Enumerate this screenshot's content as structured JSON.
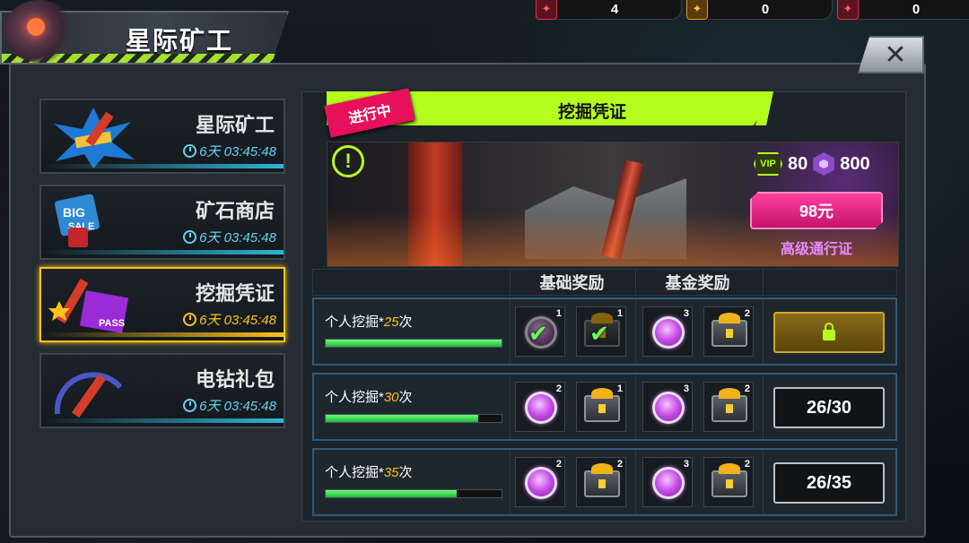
{
  "resources": [
    {
      "icon": "red-drill-icon",
      "value": "4",
      "color": "#e0304a"
    },
    {
      "icon": "gold-drill-icon",
      "value": "0",
      "color": "#e39a1a"
    },
    {
      "icon": "pink-drill-icon",
      "value": "0",
      "color": "#e0304a"
    }
  ],
  "title": "星际矿工",
  "tabs": [
    {
      "name": "星际矿工",
      "time": "6天 03:45:48",
      "art": "mining-sale-icon",
      "active": false
    },
    {
      "name": "矿石商店",
      "time": "6天 03:45:48",
      "art": "big-sale-icon",
      "active": false
    },
    {
      "name": "挖掘凭证",
      "time": "6天 03:45:48",
      "art": "pass-icon",
      "active": true
    },
    {
      "name": "电钻礼包",
      "time": "6天 03:45:48",
      "art": "drill-pack-icon",
      "active": false
    }
  ],
  "event": {
    "status": "进行中",
    "title": "挖掘凭证",
    "vip": "VIP",
    "vip_points": "80",
    "gems": "800",
    "price": "98元",
    "pass_name": "高级通行证"
  },
  "columns": {
    "basic": "基础奖励",
    "fund": "基金奖励"
  },
  "rows": [
    {
      "label": "个人挖掘*",
      "count": "25",
      "suffix": "次",
      "progress": 1.0,
      "items": [
        {
          "type": "bottlecap",
          "qty": "1",
          "claimed": true
        },
        {
          "type": "chest",
          "qty": "1",
          "claimed": true
        },
        {
          "type": "bottlecap",
          "qty": "3",
          "claimed": false
        },
        {
          "type": "chest",
          "qty": "2",
          "claimed": false
        }
      ],
      "action": "",
      "locked": true
    },
    {
      "label": "个人挖掘*",
      "count": "30",
      "suffix": "次",
      "progress": 0.867,
      "items": [
        {
          "type": "bottlecap",
          "qty": "2",
          "claimed": false
        },
        {
          "type": "chest",
          "qty": "1",
          "claimed": false
        },
        {
          "type": "bottlecap",
          "qty": "3",
          "claimed": false
        },
        {
          "type": "chest",
          "qty": "2",
          "claimed": false
        }
      ],
      "action": "26/30",
      "locked": false
    },
    {
      "label": "个人挖掘*",
      "count": "35",
      "suffix": "次",
      "progress": 0.743,
      "items": [
        {
          "type": "bottlecap",
          "qty": "2",
          "claimed": false
        },
        {
          "type": "chest",
          "qty": "2",
          "claimed": false
        },
        {
          "type": "bottlecap",
          "qty": "3",
          "claimed": false
        },
        {
          "type": "chest",
          "qty": "2",
          "claimed": false
        }
      ],
      "action": "26/35",
      "locked": false
    }
  ]
}
